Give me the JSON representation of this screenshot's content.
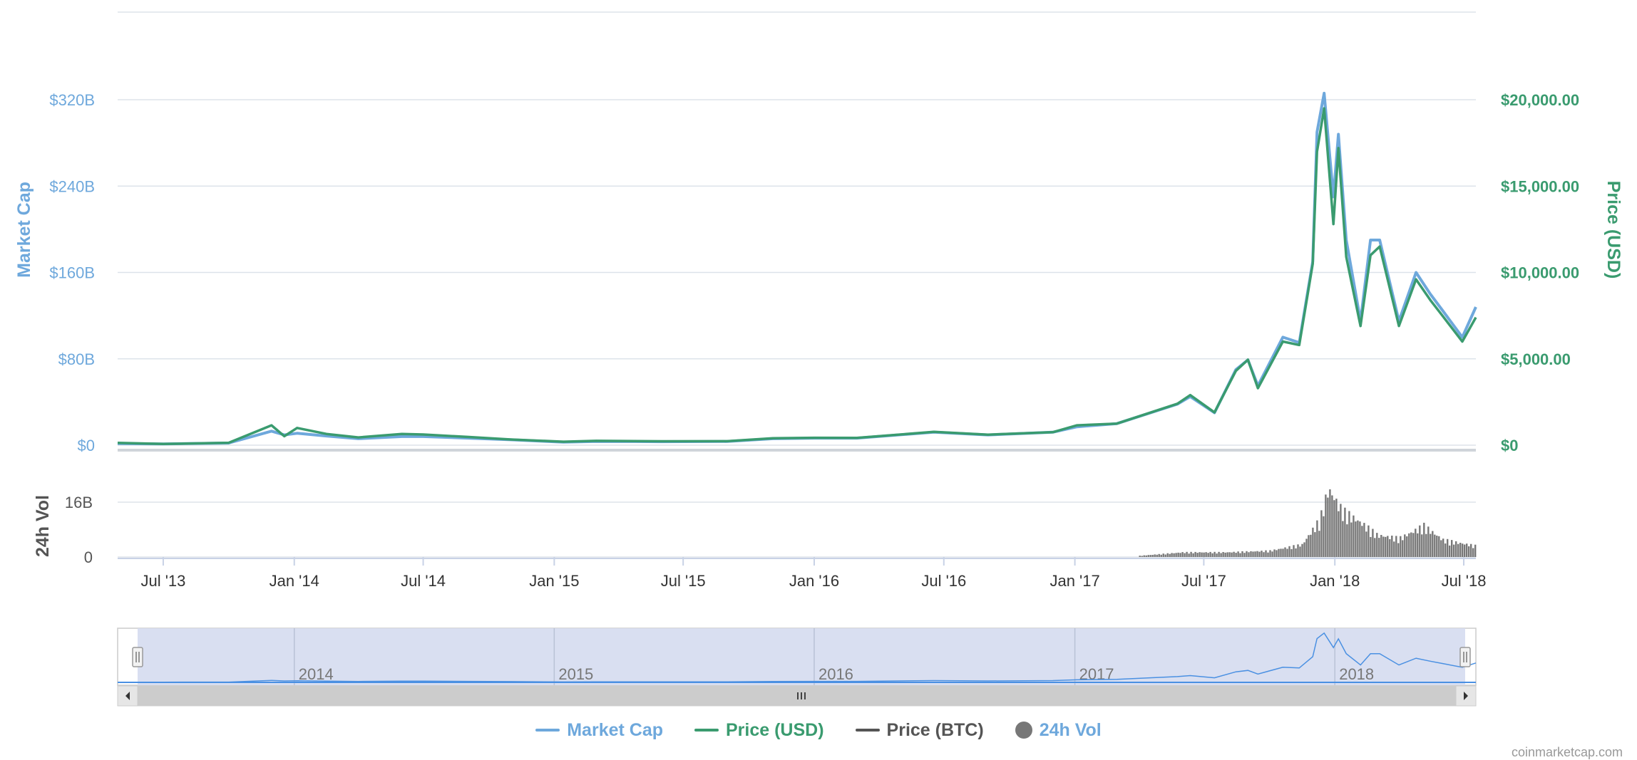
{
  "colors": {
    "market_cap": "#6ea8dc",
    "price_usd": "#3a9b6f",
    "price_btc": "#555555",
    "volume": "#777777",
    "grid": "#dde3ea",
    "navigator_mask": "#d5dcef",
    "navigator_line": "#4a90e2"
  },
  "chart_data": {
    "type": "line",
    "x_ticks": [
      "Jul '13",
      "Jan '14",
      "Jul '14",
      "Jan '15",
      "Jul '15",
      "Jan '16",
      "Jul '16",
      "Jan '17",
      "Jul '17",
      "Jan '18",
      "Jul '18"
    ],
    "y_left": {
      "label": "Market Cap",
      "ticks": [
        "$0",
        "$80B",
        "$160B",
        "$240B",
        "$320B"
      ],
      "range": [
        0,
        320
      ]
    },
    "y_right": {
      "label": "Price (USD)",
      "ticks": [
        "$0",
        "$5,000.00",
        "$10,000.00",
        "$15,000.00",
        "$20,000.00"
      ],
      "range": [
        0,
        20000
      ]
    },
    "volume_axis": {
      "label": "24h Vol",
      "ticks": [
        "0",
        "16B"
      ],
      "range": [
        0,
        32
      ]
    },
    "navigator_years": [
      "2014",
      "2015",
      "2016",
      "2017",
      "2018"
    ],
    "series": [
      {
        "name": "Market Cap",
        "x": [
          "2013-04-28",
          "2013-07-01",
          "2013-10-01",
          "2013-11-30",
          "2013-12-18",
          "2014-01-05",
          "2014-02-15",
          "2014-04-01",
          "2014-06-01",
          "2014-07-01",
          "2014-09-01",
          "2014-11-01",
          "2015-01-14",
          "2015-03-01",
          "2015-06-01",
          "2015-09-01",
          "2015-11-04",
          "2016-01-01",
          "2016-03-01",
          "2016-06-17",
          "2016-09-01",
          "2016-12-01",
          "2017-01-04",
          "2017-03-01",
          "2017-05-25",
          "2017-06-12",
          "2017-07-16",
          "2017-08-15",
          "2017-09-01",
          "2017-09-15",
          "2017-10-20",
          "2017-11-12",
          "2017-12-01",
          "2017-12-07",
          "2017-12-17",
          "2017-12-30",
          "2018-01-06",
          "2018-01-17",
          "2018-02-06",
          "2018-02-20",
          "2018-03-05",
          "2018-04-01",
          "2018-04-25",
          "2018-05-15",
          "2018-06-01",
          "2018-06-29",
          "2018-07-18"
        ],
        "values": [
          1.5,
          1.2,
          2.0,
          13.0,
          9.5,
          11.0,
          8.5,
          6.0,
          8.0,
          8.0,
          6.5,
          5.0,
          2.8,
          3.5,
          3.2,
          3.4,
          6.0,
          6.5,
          6.5,
          12.0,
          9.5,
          12.0,
          17.0,
          20.0,
          38.0,
          45.0,
          30.0,
          70.0,
          79.0,
          55.0,
          100.0,
          95.0,
          170.0,
          290.0,
          326.0,
          230.0,
          288.0,
          190.0,
          115.0,
          190.0,
          190.0,
          115.0,
          160.0,
          140.0,
          125.0,
          100.0,
          128.0
        ]
      },
      {
        "name": "Price (USD)",
        "x": [
          "2013-04-28",
          "2013-07-01",
          "2013-10-01",
          "2013-11-30",
          "2013-12-18",
          "2014-01-05",
          "2014-02-15",
          "2014-04-01",
          "2014-06-01",
          "2014-07-01",
          "2014-09-01",
          "2014-11-01",
          "2015-01-14",
          "2015-03-01",
          "2015-06-01",
          "2015-09-01",
          "2015-11-04",
          "2016-01-01",
          "2016-03-01",
          "2016-06-17",
          "2016-09-01",
          "2016-12-01",
          "2017-01-04",
          "2017-03-01",
          "2017-05-25",
          "2017-06-12",
          "2017-07-16",
          "2017-08-15",
          "2017-09-01",
          "2017-09-15",
          "2017-10-20",
          "2017-11-12",
          "2017-12-01",
          "2017-12-07",
          "2017-12-17",
          "2017-12-30",
          "2018-01-06",
          "2018-01-17",
          "2018-02-06",
          "2018-02-20",
          "2018-03-05",
          "2018-04-01",
          "2018-04-25",
          "2018-05-15",
          "2018-06-01",
          "2018-06-29",
          "2018-07-18"
        ],
        "values": [
          135,
          70,
          140,
          1150,
          520,
          1000,
          650,
          450,
          650,
          620,
          480,
          330,
          200,
          250,
          225,
          230,
          400,
          430,
          420,
          770,
          610,
          750,
          1150,
          1250,
          2400,
          2900,
          1900,
          4300,
          4950,
          3300,
          6000,
          5800,
          10500,
          17000,
          19500,
          12800,
          17200,
          10900,
          6900,
          11000,
          11500,
          6900,
          9600,
          8400,
          7500,
          6000,
          7400
        ]
      },
      {
        "name": "24h Vol",
        "x": [
          "2017-04-01",
          "2017-06-01",
          "2017-08-01",
          "2017-10-01",
          "2017-11-15",
          "2017-12-10",
          "2017-12-22",
          "2018-01-10",
          "2018-02-06",
          "2018-03-01",
          "2018-04-01",
          "2018-05-05",
          "2018-06-01",
          "2018-07-18"
        ],
        "values": [
          0.4,
          1.5,
          1.5,
          2.0,
          4.0,
          12.0,
          22.0,
          15.0,
          11.0,
          7.0,
          6.0,
          10.0,
          5.5,
          3.5
        ]
      }
    ]
  },
  "legend": {
    "items": [
      {
        "label": "Market Cap",
        "swatch": "line",
        "color": "#6ea8dc"
      },
      {
        "label": "Price (USD)",
        "swatch": "line",
        "color": "#3a9b6f"
      },
      {
        "label": "Price (BTC)",
        "swatch": "line",
        "color": "#555555"
      },
      {
        "label": "24h Vol",
        "swatch": "dot",
        "color": "#777777"
      }
    ]
  },
  "credits": "coinmarketcap.com"
}
